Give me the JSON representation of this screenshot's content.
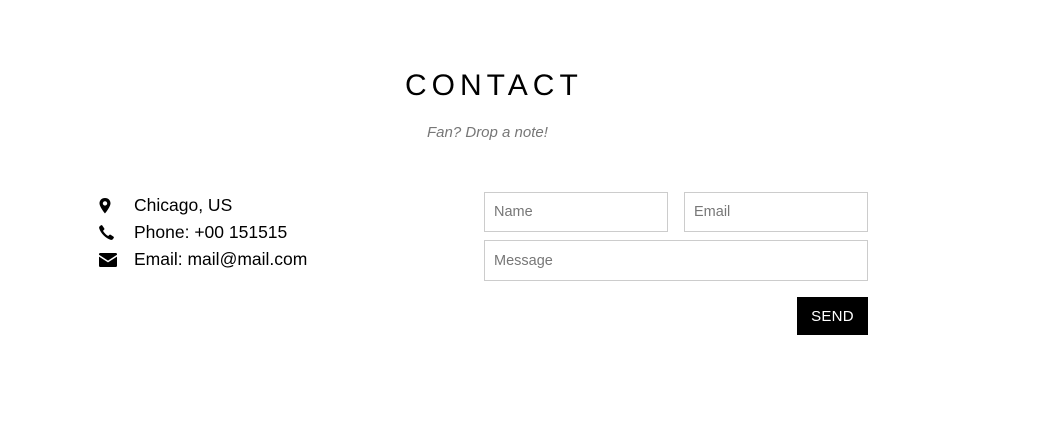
{
  "contact": {
    "title": "CONTACT",
    "subtitle": "Fan? Drop a note!"
  },
  "info": {
    "items": [
      {
        "icon": "map-marker-icon",
        "text": "Chicago, US"
      },
      {
        "icon": "phone-icon",
        "text": "Phone: +00 151515"
      },
      {
        "icon": "envelope-icon",
        "text": "Email: mail@mail.com"
      }
    ]
  },
  "form": {
    "name_placeholder": "Name",
    "name_value": "",
    "email_placeholder": "Email",
    "email_value": "",
    "message_placeholder": "Message",
    "message_value": "",
    "send_label": "SEND"
  },
  "colors": {
    "text": "#000000",
    "subtitle": "#777777",
    "field_border": "#cccccc",
    "button_bg": "#000000",
    "button_text": "#ffffff"
  }
}
